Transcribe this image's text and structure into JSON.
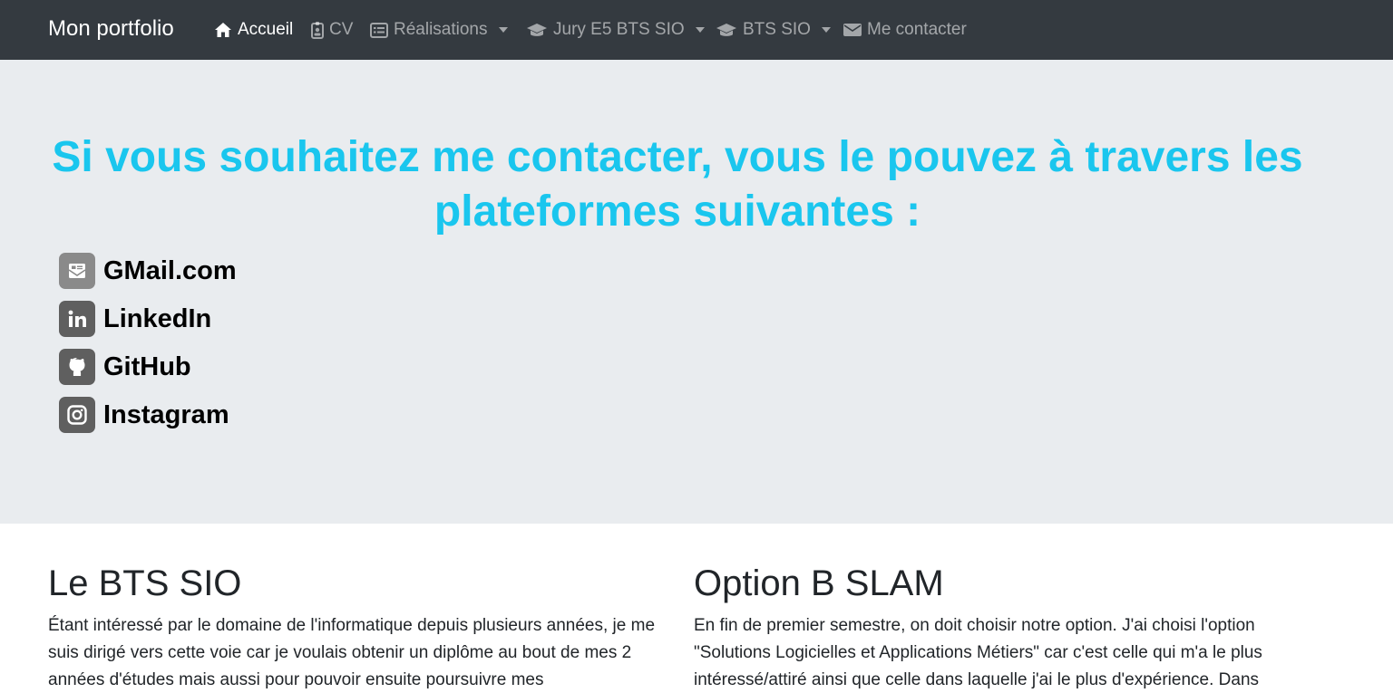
{
  "navbar": {
    "brand": "Mon portfolio",
    "items": [
      {
        "label": "Accueil",
        "icon": "home-icon",
        "active": true
      },
      {
        "label": "CV",
        "icon": "id-badge-icon"
      },
      {
        "label": "Réalisations",
        "icon": "list-alt-icon",
        "dropdown": true
      },
      {
        "label": "Jury E5 BTS SIO",
        "icon": "graduation-cap-icon",
        "dropdown": true
      },
      {
        "label": "BTS SIO",
        "icon": "graduation-cap-icon",
        "dropdown": true
      },
      {
        "label": "Me contacter",
        "icon": "envelope-icon"
      }
    ]
  },
  "jumbotron": {
    "title": "Si vous souhaitez me contacter, vous le pouvez à travers les plateformes suivantes :",
    "title_color": "#1ac6ee",
    "contacts": [
      {
        "label": "GMail.com",
        "icon": "mail-icon"
      },
      {
        "label": "LinkedIn",
        "icon": "linkedin-icon"
      },
      {
        "label": "GitHub",
        "icon": "github-icon"
      },
      {
        "label": "Instagram",
        "icon": "instagram-icon"
      }
    ]
  },
  "sections": {
    "left": {
      "title": "Le BTS SIO",
      "text": "Étant intéressé par le domaine de l'informatique depuis plusieurs années, je me suis dirigé vers cette voie car je voulais obtenir un diplôme au bout de mes 2 années d'études mais aussi pour pouvoir ensuite poursuivre mes"
    },
    "right": {
      "title": "Option B SLAM",
      "text": "En fin de premier semestre, on doit choisir notre option. J'ai choisi l'option \"Solutions Logicielles et Applications Métiers\" car c'est celle qui m'a le plus intéressé/attiré ainsi que celle dans laquelle j'ai le plus d'expérience. Dans"
    }
  }
}
